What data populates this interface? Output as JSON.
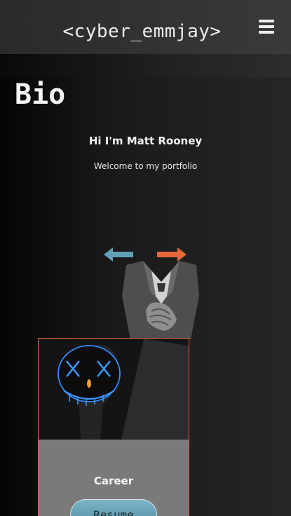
{
  "header": {
    "brand": "<cyber_emmjay>",
    "menu_icon": "hamburger-menu-icon"
  },
  "main": {
    "title": "Bio",
    "greeting": "Hi I'm Matt Rooney",
    "welcome": "Welcome to my portfolio",
    "prev_icon": "arrow-left-icon",
    "next_icon": "arrow-right-icon",
    "figure_icon": "suited-figure-illustration"
  },
  "card": {
    "image_icon": "neon-mask-photo",
    "label": "Career",
    "button_label": "Resume"
  },
  "colors": {
    "accent_orange": "#e8673a",
    "accent_blue": "#5fa2b8",
    "card_border": "#d9643a",
    "neon_blue": "#2f8cff"
  }
}
